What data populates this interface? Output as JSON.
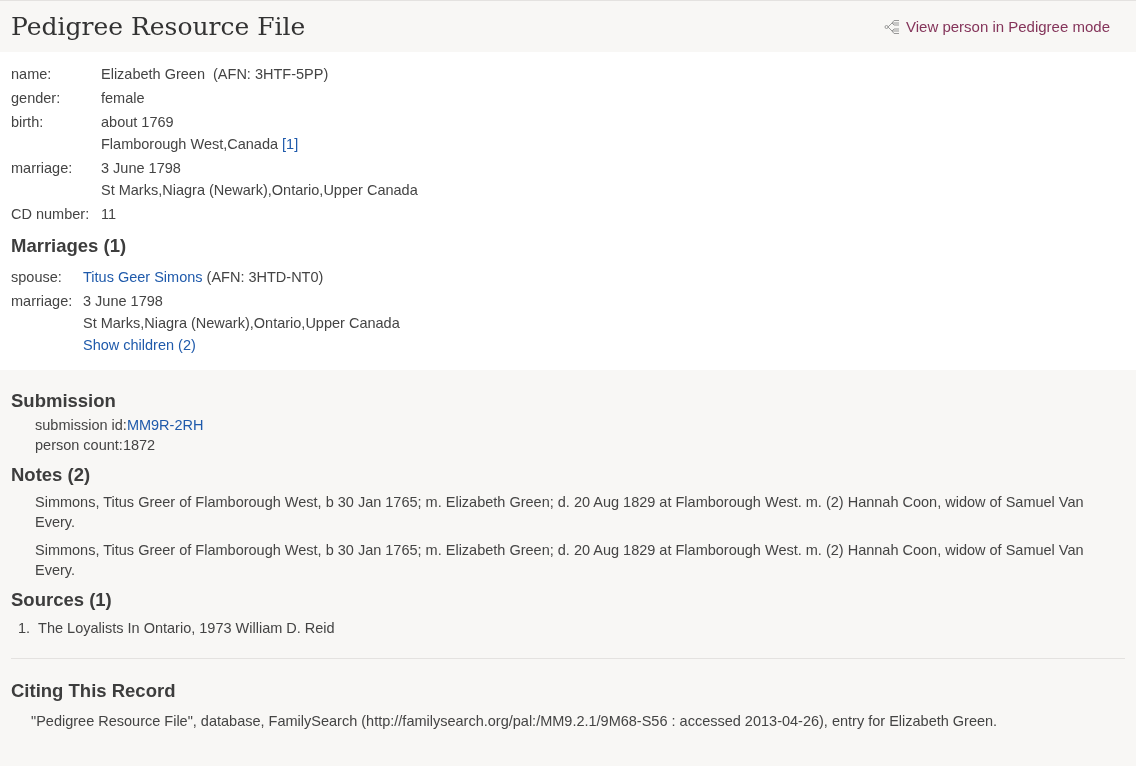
{
  "header": {
    "title": "Pedigree Resource File",
    "pedigree_link": "View person in Pedigree mode"
  },
  "person": [
    {
      "label": "name:",
      "lines": [
        [
          {
            "kind": "text",
            "text": "Elizabeth Green  (AFN: 3HTF-5PP)"
          }
        ]
      ]
    },
    {
      "label": "gender:",
      "lines": [
        [
          {
            "kind": "text",
            "text": "female"
          }
        ]
      ]
    },
    {
      "label": "birth:",
      "lines": [
        [
          {
            "kind": "text",
            "text": "about 1769"
          }
        ],
        [
          {
            "kind": "text",
            "text": "Flamborough West,Canada"
          },
          {
            "kind": "link",
            "text": "[1]"
          }
        ]
      ]
    },
    {
      "label": "marriage:",
      "lines": [
        [
          {
            "kind": "text",
            "text": "3 June 1798"
          }
        ],
        [
          {
            "kind": "text",
            "text": "St Marks,Niagra (Newark),Ontario,Upper Canada"
          }
        ]
      ]
    },
    {
      "label": "CD number:",
      "lines": [
        [
          {
            "kind": "text",
            "text": "11"
          }
        ]
      ]
    }
  ],
  "marriages": {
    "heading": "Marriages (1)",
    "rows": [
      {
        "label": "spouse:",
        "lines": [
          [
            {
              "kind": "link",
              "text": "Titus Geer Simons"
            },
            {
              "kind": "text",
              "text": " (AFN: 3HTD-NT0)"
            }
          ]
        ]
      },
      {
        "label": "marriage:",
        "lines": [
          [
            {
              "kind": "text",
              "text": "3 June 1798"
            }
          ],
          [
            {
              "kind": "text",
              "text": "St Marks,Niagra (Newark),Ontario,Upper Canada"
            }
          ],
          [
            {
              "kind": "link",
              "text": "Show children (2)"
            }
          ]
        ]
      }
    ]
  },
  "submission": {
    "heading": "Submission",
    "items": [
      {
        "label": "submission id:",
        "value": "MM9R-2RH",
        "kind": "link"
      },
      {
        "label": "person count:",
        "value": "1872",
        "kind": "text"
      }
    ]
  },
  "notes": {
    "heading": "Notes (2)",
    "items": [
      "Simmons, Titus Greer of Flamborough West, b 30 Jan 1765; m. Elizabeth Green; d. 20 Aug 1829 at Flamborough West. m. (2) Hannah Coon, widow of Samuel Van Every.",
      "Simmons, Titus Greer of Flamborough West, b 30 Jan 1765; m. Elizabeth Green; d. 20 Aug 1829 at Flamborough West. m. (2) Hannah Coon, widow of Samuel Van Every."
    ]
  },
  "sources": {
    "heading": "Sources (1)",
    "items": [
      {
        "number": "1.",
        "text": "The Loyalists In Ontario, 1973 William D. Reid"
      }
    ]
  },
  "citing": {
    "heading": "Citing This Record",
    "text": "\"Pedigree Resource File\", database, FamilySearch (http://familysearch.org/pal:/MM9.2.1/9M68-S56 : accessed 2013-04-26), entry for Elizabeth Green."
  }
}
